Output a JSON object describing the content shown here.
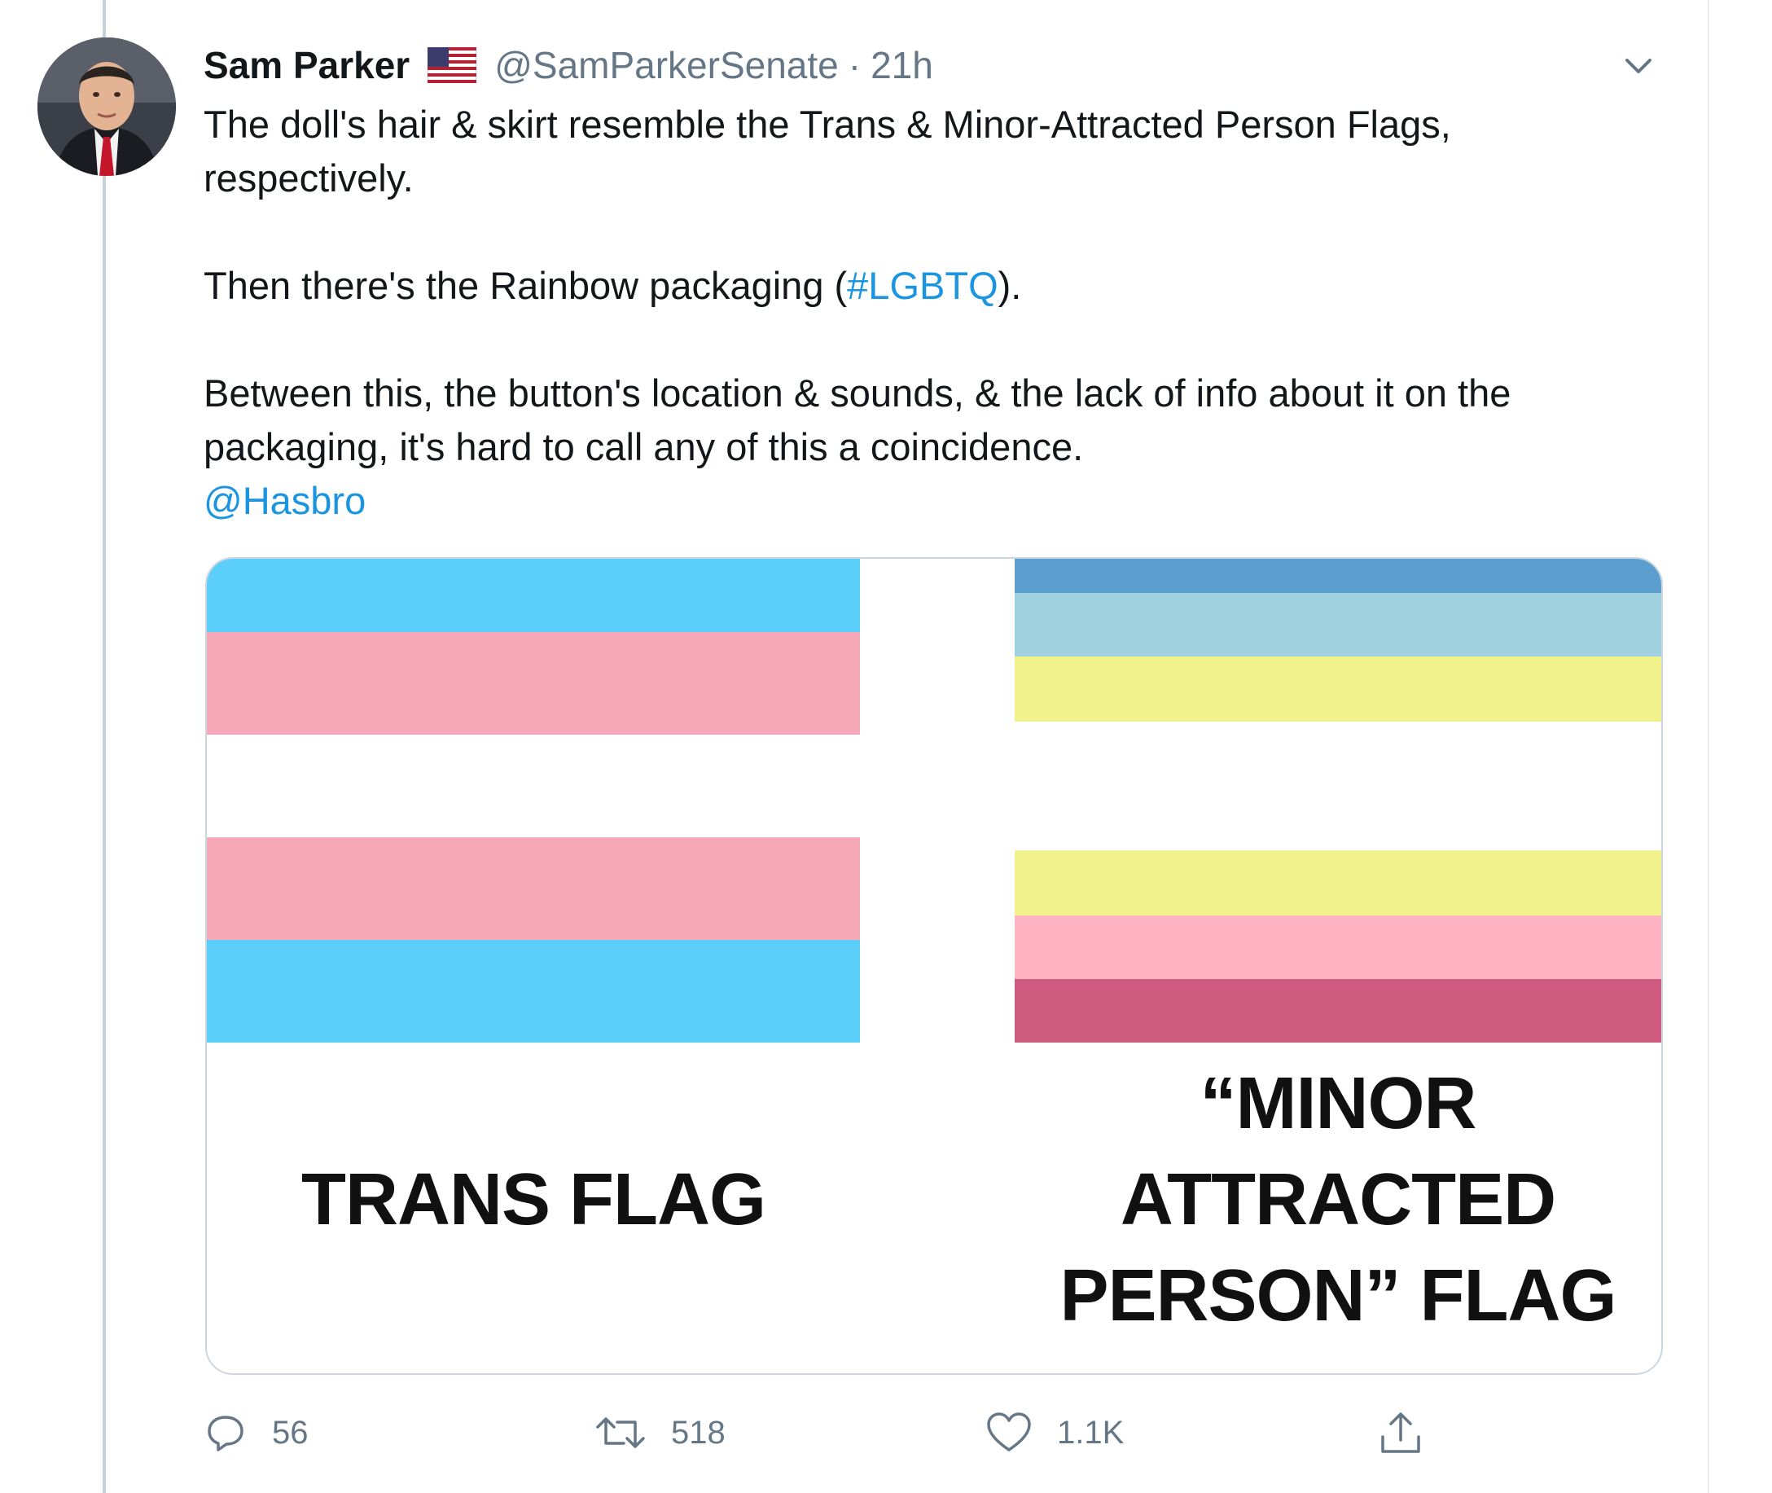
{
  "tweet": {
    "author": {
      "name": "Sam Parker",
      "flag_icon": "us-flag-icon",
      "handle": "@SamParkerSenate",
      "separator": "·",
      "time": "21h"
    },
    "text": {
      "line1": "The doll's hair & skirt resemble the Trans & Minor-Attracted Person Flags, respectively.",
      "line2_prefix": "Then there's the Rainbow packaging (",
      "line2_hashtag": "#LGBTQ",
      "line2_suffix": ").",
      "line3": "Between this, the button's location & sounds, & the lack of info about it on the packaging, it's hard to call any of this a coincidence.",
      "mention": "@Hasbro"
    },
    "media": {
      "left_label": "TRANS FLAG",
      "right_label_line1": "“MINOR",
      "right_label_line2": "ATTRACTED",
      "right_label_line3": "PERSON” FLAG",
      "trans_colors": [
        "#5bcefa",
        "#f5a9b8",
        "#ffffff",
        "#f5a9b8",
        "#5bcefa"
      ],
      "map_colors": [
        "#5a9fd0",
        "#9fd2de",
        "#f2f28c",
        "#ffffff",
        "#f2f28c",
        "#ffb3c2",
        "#cf5a7f"
      ]
    },
    "actions": {
      "reply_count": "56",
      "retweet_count": "518",
      "like_count": "1.1K",
      "reply_icon": "reply-icon",
      "retweet_icon": "retweet-icon",
      "like_icon": "heart-icon",
      "share_icon": "share-icon"
    },
    "menu_icon": "chevron-down-icon"
  }
}
